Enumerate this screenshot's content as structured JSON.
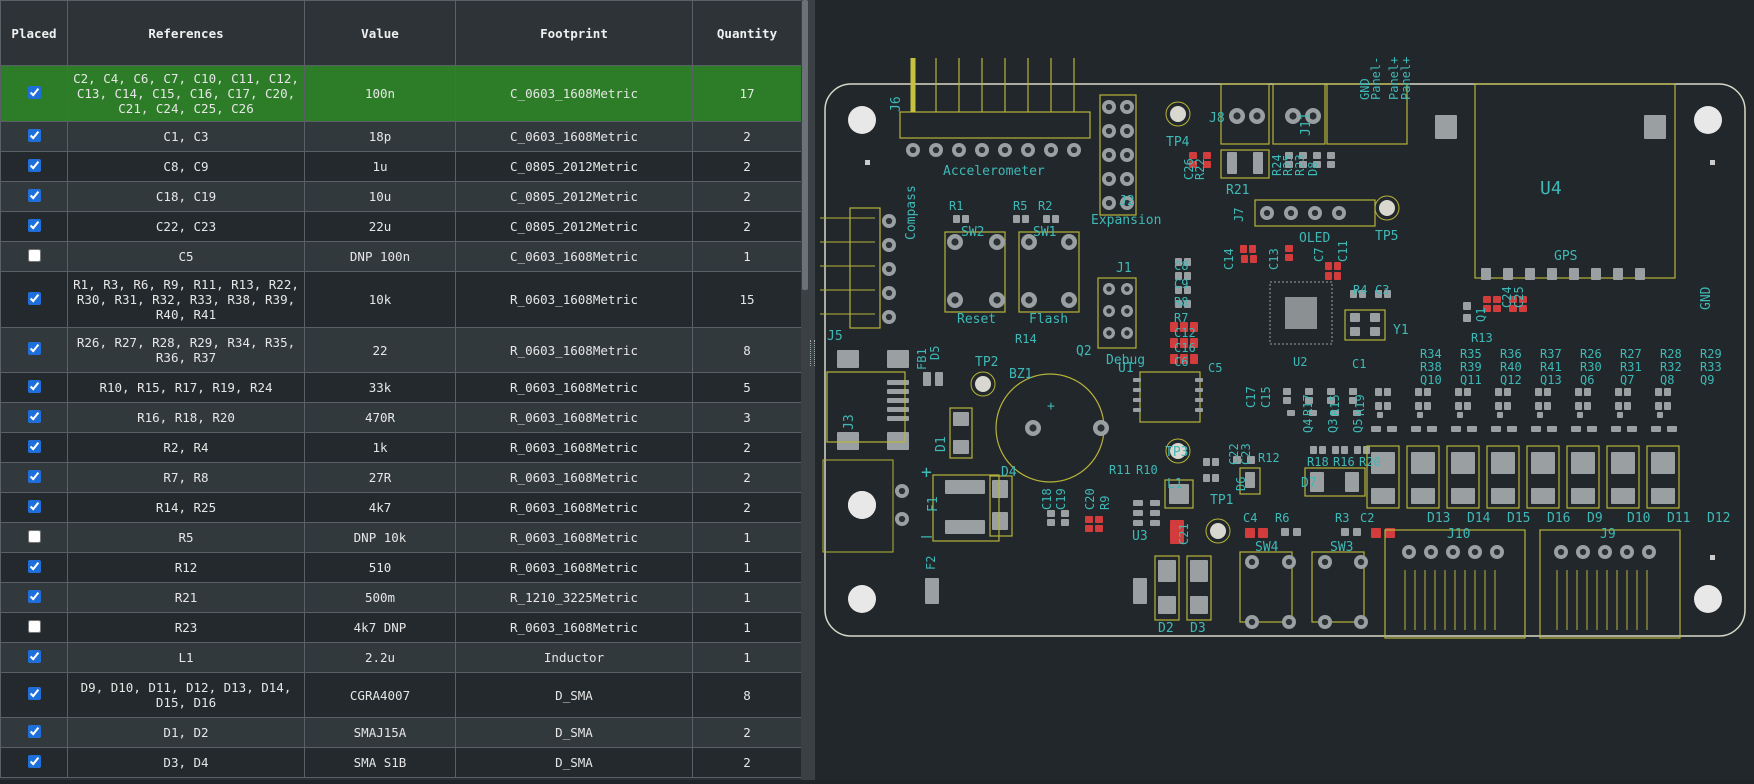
{
  "columns": [
    "Placed",
    "References",
    "Value",
    "Footprint",
    "Quantity"
  ],
  "rows": [
    {
      "placed": true,
      "refs": "C2, C4, C6, C7, C10, C11, C12, C13, C14, C15, C16, C17, C20, C21, C24, C25, C26",
      "value": "100n",
      "footprint": "C_0603_1608Metric",
      "qty": "17",
      "selected": true
    },
    {
      "placed": true,
      "refs": "C1, C3",
      "value": "18p",
      "footprint": "C_0603_1608Metric",
      "qty": "2"
    },
    {
      "placed": true,
      "refs": "C8, C9",
      "value": "1u",
      "footprint": "C_0805_2012Metric",
      "qty": "2"
    },
    {
      "placed": true,
      "refs": "C18, C19",
      "value": "10u",
      "footprint": "C_0805_2012Metric",
      "qty": "2"
    },
    {
      "placed": true,
      "refs": "C22, C23",
      "value": "22u",
      "footprint": "C_0805_2012Metric",
      "qty": "2"
    },
    {
      "placed": false,
      "refs": "C5",
      "value": "DNP 100n",
      "footprint": "C_0603_1608Metric",
      "qty": "1"
    },
    {
      "placed": true,
      "refs": "R1, R3, R6, R9, R11, R13, R22, R30, R31, R32, R33, R38, R39, R40, R41",
      "value": "10k",
      "footprint": "R_0603_1608Metric",
      "qty": "15"
    },
    {
      "placed": true,
      "refs": "R26, R27, R28, R29, R34, R35, R36, R37",
      "value": "22",
      "footprint": "R_0603_1608Metric",
      "qty": "8"
    },
    {
      "placed": true,
      "refs": "R10, R15, R17, R19, R24",
      "value": "33k",
      "footprint": "R_0603_1608Metric",
      "qty": "5"
    },
    {
      "placed": true,
      "refs": "R16, R18, R20",
      "value": "470R",
      "footprint": "R_0603_1608Metric",
      "qty": "3"
    },
    {
      "placed": true,
      "refs": "R2, R4",
      "value": "1k",
      "footprint": "R_0603_1608Metric",
      "qty": "2"
    },
    {
      "placed": true,
      "refs": "R7, R8",
      "value": "27R",
      "footprint": "R_0603_1608Metric",
      "qty": "2"
    },
    {
      "placed": true,
      "refs": "R14, R25",
      "value": "4k7",
      "footprint": "R_0603_1608Metric",
      "qty": "2"
    },
    {
      "placed": false,
      "refs": "R5",
      "value": "DNP 10k",
      "footprint": "R_0603_1608Metric",
      "qty": "1"
    },
    {
      "placed": true,
      "refs": "R12",
      "value": "510",
      "footprint": "R_0603_1608Metric",
      "qty": "1"
    },
    {
      "placed": true,
      "refs": "R21",
      "value": "500m",
      "footprint": "R_1210_3225Metric",
      "qty": "1"
    },
    {
      "placed": false,
      "refs": "R23",
      "value": "4k7 DNP",
      "footprint": "R_0603_1608Metric",
      "qty": "1"
    },
    {
      "placed": true,
      "refs": "L1",
      "value": "2.2u",
      "footprint": "Inductor",
      "qty": "1"
    },
    {
      "placed": true,
      "refs": "D9, D10, D11, D12, D13, D14, D15, D16",
      "value": "CGRA4007",
      "footprint": "D_SMA",
      "qty": "8"
    },
    {
      "placed": true,
      "refs": "D1, D2",
      "value": "SMAJ15A",
      "footprint": "D_SMA",
      "qty": "2"
    },
    {
      "placed": true,
      "refs": "D3, D4",
      "value": "SMA S1B",
      "footprint": "D_SMA",
      "qty": "2"
    }
  ],
  "pcb": {
    "labels": [
      {
        "t": "J6"
      },
      {
        "t": "Accelerometer"
      },
      {
        "t": "Compass"
      },
      {
        "t": "J5"
      },
      {
        "t": "SW2"
      },
      {
        "t": "SW1"
      },
      {
        "t": "R1"
      },
      {
        "t": "R5"
      },
      {
        "t": "R2"
      },
      {
        "t": "Reset"
      },
      {
        "t": "Flash"
      },
      {
        "t": "Expansion"
      },
      {
        "t": "J2"
      },
      {
        "t": "TP4"
      },
      {
        "t": "C26"
      },
      {
        "t": "R22"
      },
      {
        "t": "J8"
      },
      {
        "t": "J11"
      },
      {
        "t": "GND"
      },
      {
        "t": "Panel-"
      },
      {
        "t": "Panel+"
      },
      {
        "t": "Panel+"
      },
      {
        "t": "R21"
      },
      {
        "t": "R24"
      },
      {
        "t": "R25"
      },
      {
        "t": "R23"
      },
      {
        "t": "D8"
      },
      {
        "t": "U4"
      },
      {
        "t": "GPS"
      },
      {
        "t": "GND"
      },
      {
        "t": "TP5"
      },
      {
        "t": "J7"
      },
      {
        "t": "OLED"
      },
      {
        "t": "C14"
      },
      {
        "t": "C13"
      },
      {
        "t": "C7"
      },
      {
        "t": "C11"
      },
      {
        "t": "J1"
      },
      {
        "t": "Debug"
      },
      {
        "t": "C8"
      },
      {
        "t": "C9"
      },
      {
        "t": "R8"
      },
      {
        "t": "R7"
      },
      {
        "t": "C12"
      },
      {
        "t": "C16"
      },
      {
        "t": "C6"
      },
      {
        "t": "U2"
      },
      {
        "t": "R4"
      },
      {
        "t": "C3"
      },
      {
        "t": "Y1"
      },
      {
        "t": "C1"
      },
      {
        "t": "Q1"
      },
      {
        "t": "C24"
      },
      {
        "t": "C25"
      },
      {
        "t": "R13"
      },
      {
        "t": "R14"
      },
      {
        "t": "Q2"
      },
      {
        "t": "TP2"
      },
      {
        "t": "BZ1"
      },
      {
        "t": "U1"
      },
      {
        "t": "C5"
      },
      {
        "t": "FB1"
      },
      {
        "t": "D5"
      },
      {
        "t": "J3"
      },
      {
        "t": "D1"
      },
      {
        "t": "D4"
      },
      {
        "t": "C17"
      },
      {
        "t": "C15"
      },
      {
        "t": "R17"
      },
      {
        "t": "Q4"
      },
      {
        "t": "R15"
      },
      {
        "t": "Q3"
      },
      {
        "t": "R19"
      },
      {
        "t": "Q5"
      },
      {
        "t": "R34"
      },
      {
        "t": "R38"
      },
      {
        "t": "Q10"
      },
      {
        "t": "R35"
      },
      {
        "t": "R39"
      },
      {
        "t": "Q11"
      },
      {
        "t": "R36"
      },
      {
        "t": "R40"
      },
      {
        "t": "Q12"
      },
      {
        "t": "R37"
      },
      {
        "t": "R41"
      },
      {
        "t": "Q13"
      },
      {
        "t": "R26"
      },
      {
        "t": "R30"
      },
      {
        "t": "Q6"
      },
      {
        "t": "R27"
      },
      {
        "t": "R31"
      },
      {
        "t": "Q7"
      },
      {
        "t": "R28"
      },
      {
        "t": "R32"
      },
      {
        "t": "Q8"
      },
      {
        "t": "R29"
      },
      {
        "t": "R33"
      },
      {
        "t": "Q9"
      },
      {
        "t": "TP3"
      },
      {
        "t": "C22"
      },
      {
        "t": "C23"
      },
      {
        "t": "R12"
      },
      {
        "t": "D6"
      },
      {
        "t": "R18"
      },
      {
        "t": "R16"
      },
      {
        "t": "R20"
      },
      {
        "t": "D7"
      },
      {
        "t": "D13"
      },
      {
        "t": "D14"
      },
      {
        "t": "D15"
      },
      {
        "t": "D16"
      },
      {
        "t": "D9"
      },
      {
        "t": "D10"
      },
      {
        "t": "D11"
      },
      {
        "t": "D12"
      },
      {
        "t": "R11"
      },
      {
        "t": "R10"
      },
      {
        "t": "L1"
      },
      {
        "t": "C18"
      },
      {
        "t": "C19"
      },
      {
        "t": "C20"
      },
      {
        "t": "R9"
      },
      {
        "t": "F1"
      },
      {
        "t": "U3"
      },
      {
        "t": "C21"
      },
      {
        "t": "TP1"
      },
      {
        "t": "C4"
      },
      {
        "t": "R6"
      },
      {
        "t": "R3"
      },
      {
        "t": "C2"
      },
      {
        "t": "SW4"
      },
      {
        "t": "SW3"
      },
      {
        "t": "J10"
      },
      {
        "t": "J9"
      },
      {
        "t": "F2"
      },
      {
        "t": "D2"
      },
      {
        "t": "D3"
      },
      {
        "t": "+"
      },
      {
        "t": "+"
      },
      {
        "t": "–"
      }
    ]
  }
}
